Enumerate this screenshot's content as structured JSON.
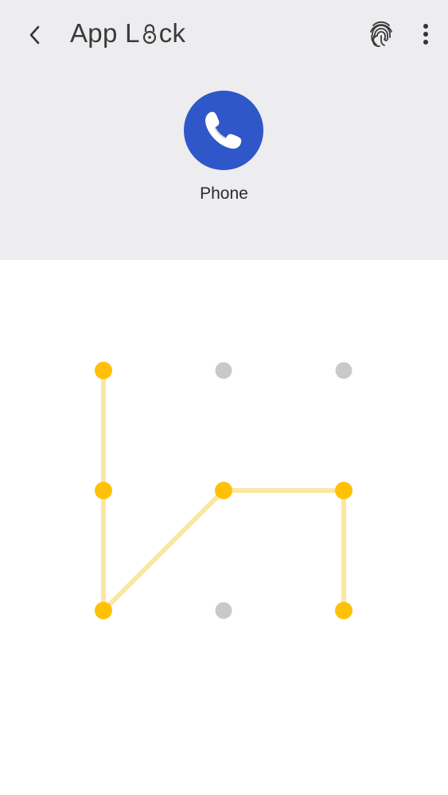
{
  "header": {
    "title_prefix": "App L",
    "title_suffix": "ck"
  },
  "app": {
    "name": "Phone",
    "icon_color": "#2f57c9"
  },
  "icons": {
    "back": "chevron-left-icon",
    "fingerprint": "fingerprint-icon",
    "more": "more-vert-icon",
    "lock_in_title": "lock-icon",
    "phone": "phone-icon"
  },
  "pattern": {
    "grid_size": 3,
    "active_color": "#ffc107",
    "line_color": "#fbe7a0",
    "inactive_color": "#c9c9c9",
    "sequence": [
      0,
      3,
      6,
      4,
      5,
      8
    ]
  }
}
